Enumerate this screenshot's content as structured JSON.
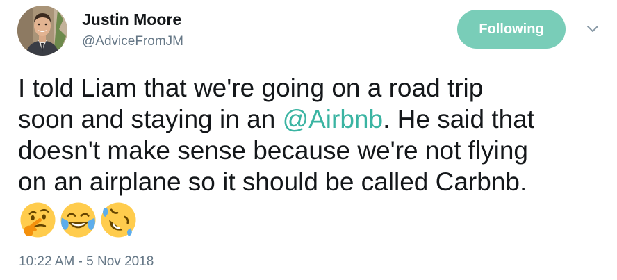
{
  "user": {
    "name": "Justin Moore",
    "handle": "@AdviceFromJM",
    "avatar_icon": "profile-photo"
  },
  "follow_button": {
    "label": "Following",
    "color": "#79cdb8"
  },
  "menu": {
    "icon": "chevron-down-icon"
  },
  "tweet": {
    "line1": "I told Liam that we're going on a road trip",
    "line2_before": "soon and staying in an ",
    "mention": "@Airbnb",
    "line2_after": ". He said that",
    "line3": "doesn't make sense because we're not flying",
    "line4": "on an airplane so it should be called Carbnb.",
    "mention_color": "#3ab4a2",
    "emojis": [
      "thinking-face-emoji",
      "face-with-tears-of-joy-emoji",
      "rolling-on-the-floor-laughing-emoji"
    ]
  },
  "timestamp": "10:22 AM - 5 Nov 2018"
}
